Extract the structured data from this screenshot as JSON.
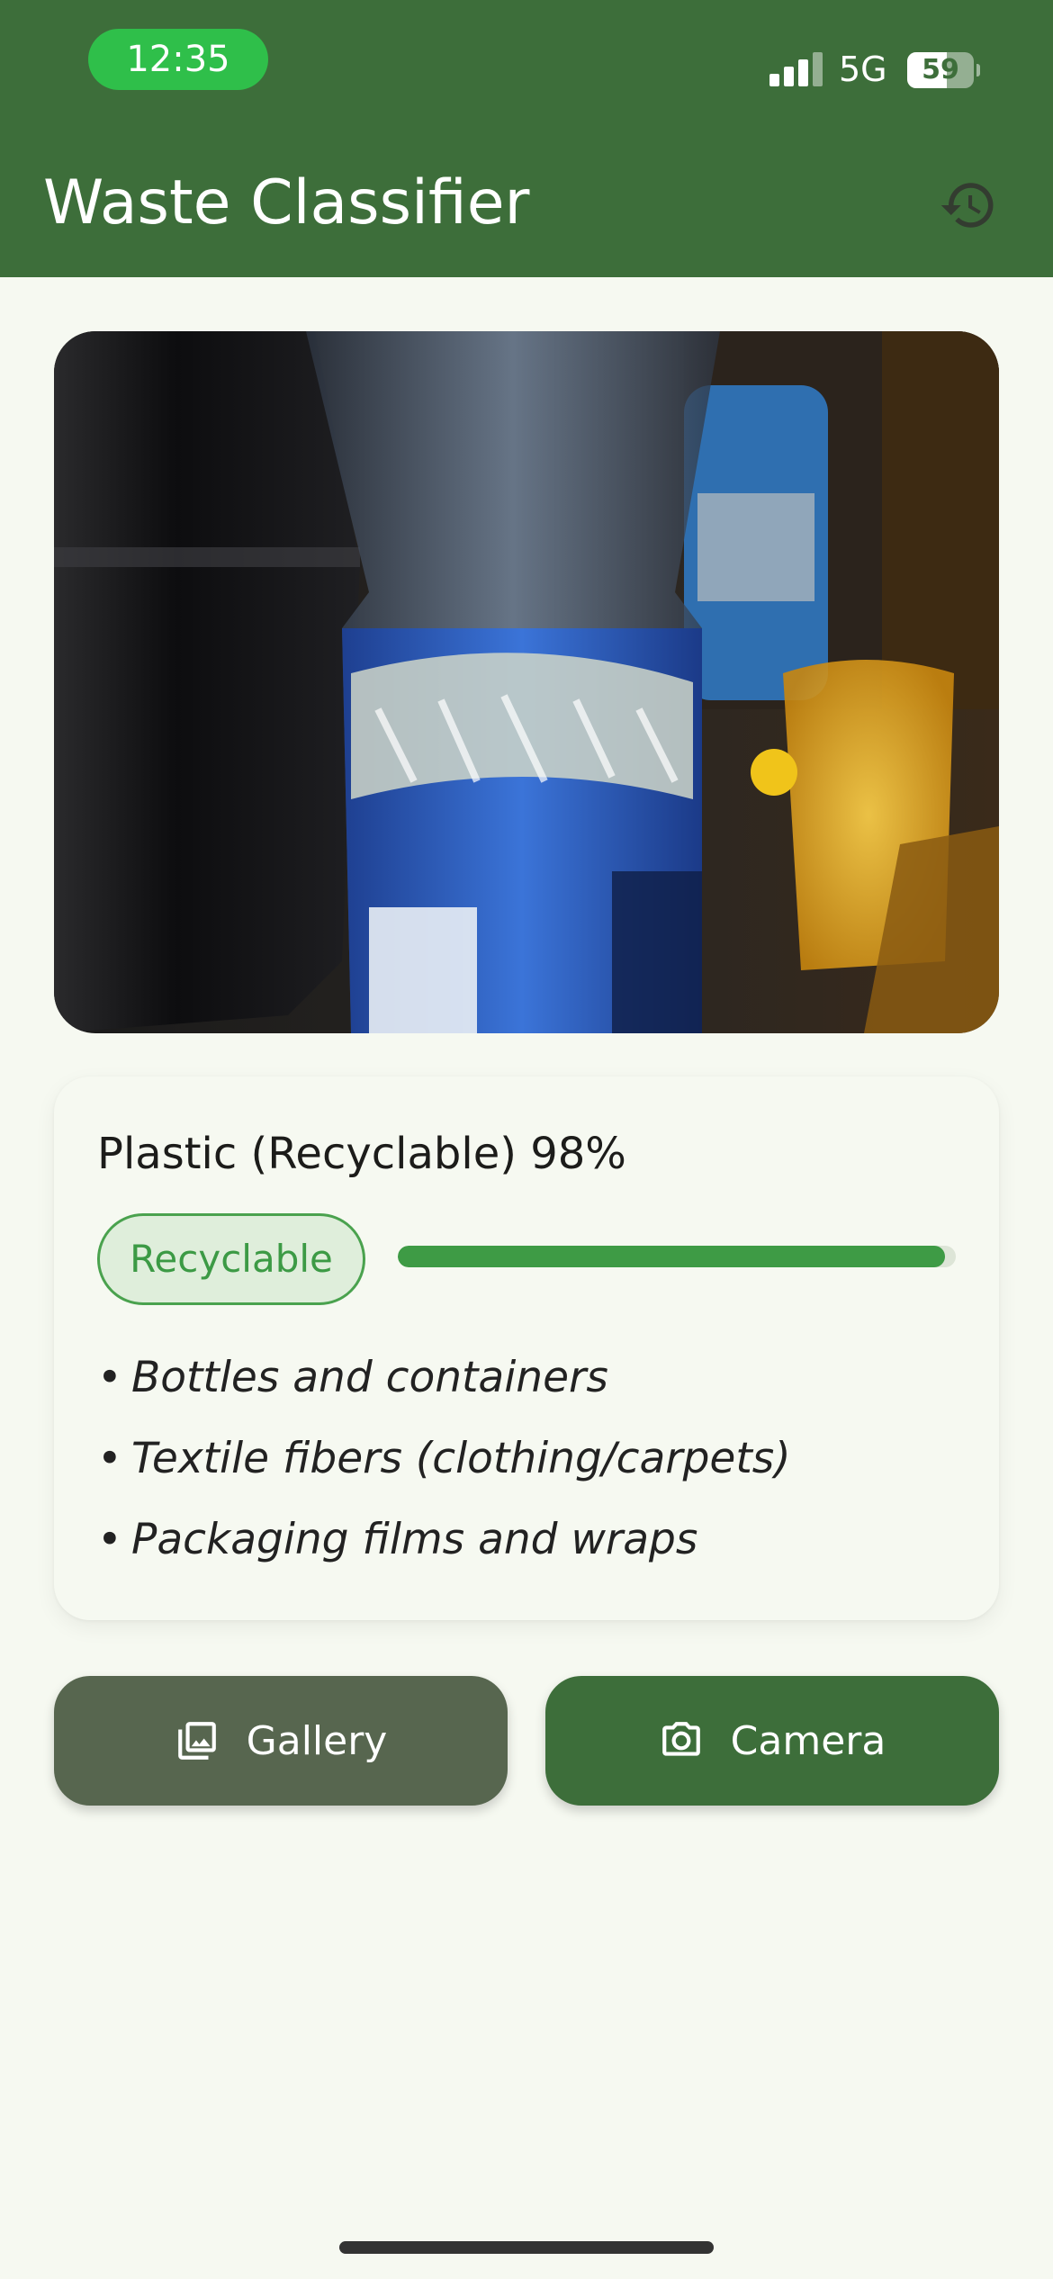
{
  "status_bar": {
    "time": "12:35",
    "network": "5G",
    "battery": "59",
    "battery_level": 0.59,
    "signal_bars": 3
  },
  "header": {
    "title": "Waste Classifier",
    "history_icon": "history-icon"
  },
  "result": {
    "title": "Plastic (Recyclable) 98%",
    "chip_label": "Recyclable",
    "confidence": 0.98,
    "examples": [
      "Bottles and containers",
      "Textile fibers (clothing/carpets)",
      "Packaging films and wraps"
    ],
    "bullet": "•"
  },
  "actions": {
    "gallery_label": "Gallery",
    "gallery_icon": "photo-library-icon",
    "camera_label": "Camera",
    "camera_icon": "camera-icon"
  },
  "colors": {
    "primary": "#3d6e3a",
    "secondary": "#57664f",
    "accent_green": "#3e9b45",
    "status_pill": "#2fbf4a",
    "background": "#f6f9f1"
  }
}
